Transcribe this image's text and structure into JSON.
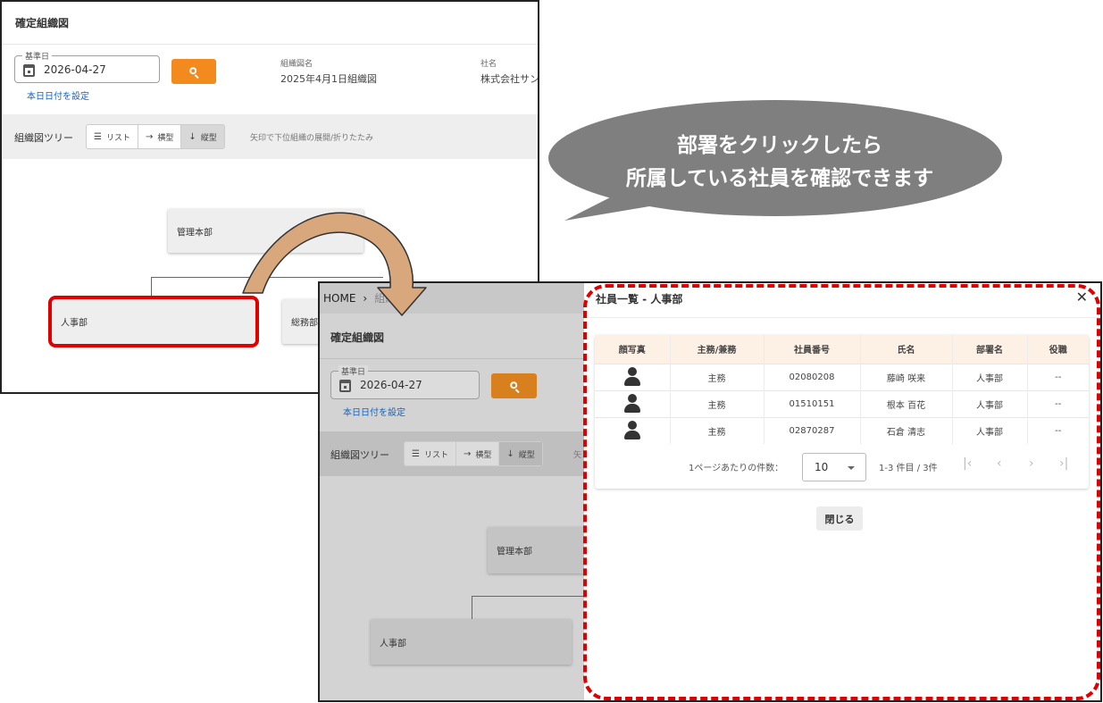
{
  "back_window": {
    "title": "確定組織図",
    "date_legend": "基準日",
    "date_value": "2026-04-27",
    "today_link": "本日日付を設定",
    "meta": [
      {
        "label": "組織図名",
        "value": "2025年4月1日組織図"
      },
      {
        "label": "社名",
        "value": "株式会社サン"
      }
    ],
    "tree_label": "組織図ツリー",
    "view_modes": [
      {
        "icon": "☰",
        "label": "リスト"
      },
      {
        "icon": "→",
        "label": "横型"
      },
      {
        "icon": "↓",
        "label": "縦型"
      }
    ],
    "tree_hint": "矢印で下位組織の展開/折りたたみ",
    "nodes": {
      "root": "管理本部",
      "hr": "人事部",
      "general": "総務部"
    }
  },
  "callout": {
    "line1": "部署をクリックしたら",
    "line2": "所属している社員を確認できます",
    "color": "#7f7f7f"
  },
  "front_window": {
    "breadcrumb": {
      "home": "HOME",
      "sep": "›",
      "current": "組織図"
    },
    "title": "確定組織図",
    "date_legend": "基準日",
    "date_value": "2026-04-27",
    "today_link": "本日日付を設定",
    "tree_label": "組織図ツリー",
    "view_modes": [
      {
        "icon": "☰",
        "label": "リスト"
      },
      {
        "icon": "→",
        "label": "横型"
      },
      {
        "icon": "↓",
        "label": "縦型"
      }
    ],
    "tree_hint": "矢",
    "nodes": {
      "root": "管理本部",
      "hr": "人事部"
    }
  },
  "dialog": {
    "title": "社員一覧 - 人事部",
    "close_icon": "✕",
    "columns": [
      "顔写真",
      "主務/兼務",
      "社員番号",
      "氏名",
      "部署名",
      "役職"
    ],
    "rows": [
      {
        "type": "主務",
        "id": "02080208",
        "name": "藤崎 咲来",
        "dept": "人事部",
        "position": "--"
      },
      {
        "type": "主務",
        "id": "01510151",
        "name": "根本 百花",
        "dept": "人事部",
        "position": "--"
      },
      {
        "type": "主務",
        "id": "02870287",
        "name": "石倉 清志",
        "dept": "人事部",
        "position": "--"
      }
    ],
    "rows_per_page_label": "1ページあたりの件数：",
    "rows_per_page": "10",
    "range": "1-3 件目 / 3件",
    "pager_icons": [
      "|‹",
      "‹",
      "›",
      "›|"
    ],
    "close_button": "閉じる"
  },
  "colors": {
    "accent_orange": "#f28a1d",
    "highlight_red": "#e00000",
    "arrow_fill": "#d9a77c",
    "header_bg": "#fdf0e4"
  }
}
